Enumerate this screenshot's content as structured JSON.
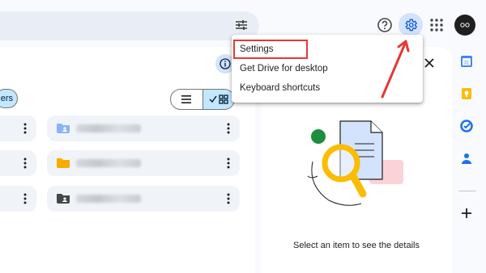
{
  "header": {
    "icons": [
      "filter-icon",
      "help-icon",
      "settings-gear-icon",
      "apps-grid-icon",
      "account-avatar"
    ]
  },
  "toolbar": {
    "filter_chip_label": "ers"
  },
  "settings_menu": {
    "items": [
      {
        "label": "Settings",
        "highlighted": true
      },
      {
        "label": "Get Drive for desktop",
        "highlighted": false
      },
      {
        "label": "Keyboard shortcuts",
        "highlighted": false
      }
    ]
  },
  "details_panel": {
    "empty_message": "Select an item to see the details"
  },
  "side_rail": {
    "icons": [
      "calendar-icon",
      "keep-icon",
      "tasks-icon",
      "contacts-icon",
      "add-icon"
    ],
    "calendar_day": "31"
  },
  "colors": {
    "accent_blue": "#c2e7ff",
    "highlight_red": "#e53935",
    "shared_folder": "#8ab4f8",
    "orange_folder": "#f9ab00",
    "dark_folder": "#444746"
  }
}
